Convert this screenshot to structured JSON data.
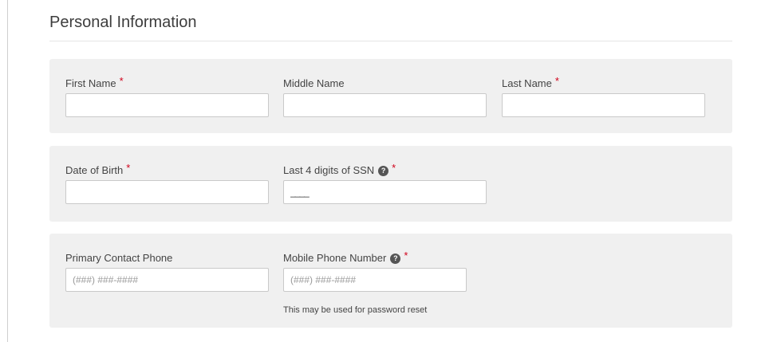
{
  "section": {
    "title": "Personal Information"
  },
  "fields": {
    "first_name": {
      "label": "First Name",
      "value": ""
    },
    "middle_name": {
      "label": "Middle Name",
      "value": ""
    },
    "last_name": {
      "label": "Last Name",
      "value": ""
    },
    "date_of_birth": {
      "label": "Date of Birth",
      "value": ""
    },
    "ssn_last4": {
      "label": "Last 4 digits of SSN",
      "value": "____"
    },
    "primary_phone": {
      "label": "Primary Contact Phone",
      "placeholder": "(###) ###-####"
    },
    "mobile_phone": {
      "label": "Mobile Phone Number",
      "placeholder": "(###) ###-####",
      "hint": "This may be used for password reset"
    }
  },
  "required_marker": "*",
  "help_icon_glyph": "?",
  "colors": {
    "required": "#d0021b",
    "panel_bg": "#f0f0f0",
    "help_icon_bg": "#555555"
  }
}
